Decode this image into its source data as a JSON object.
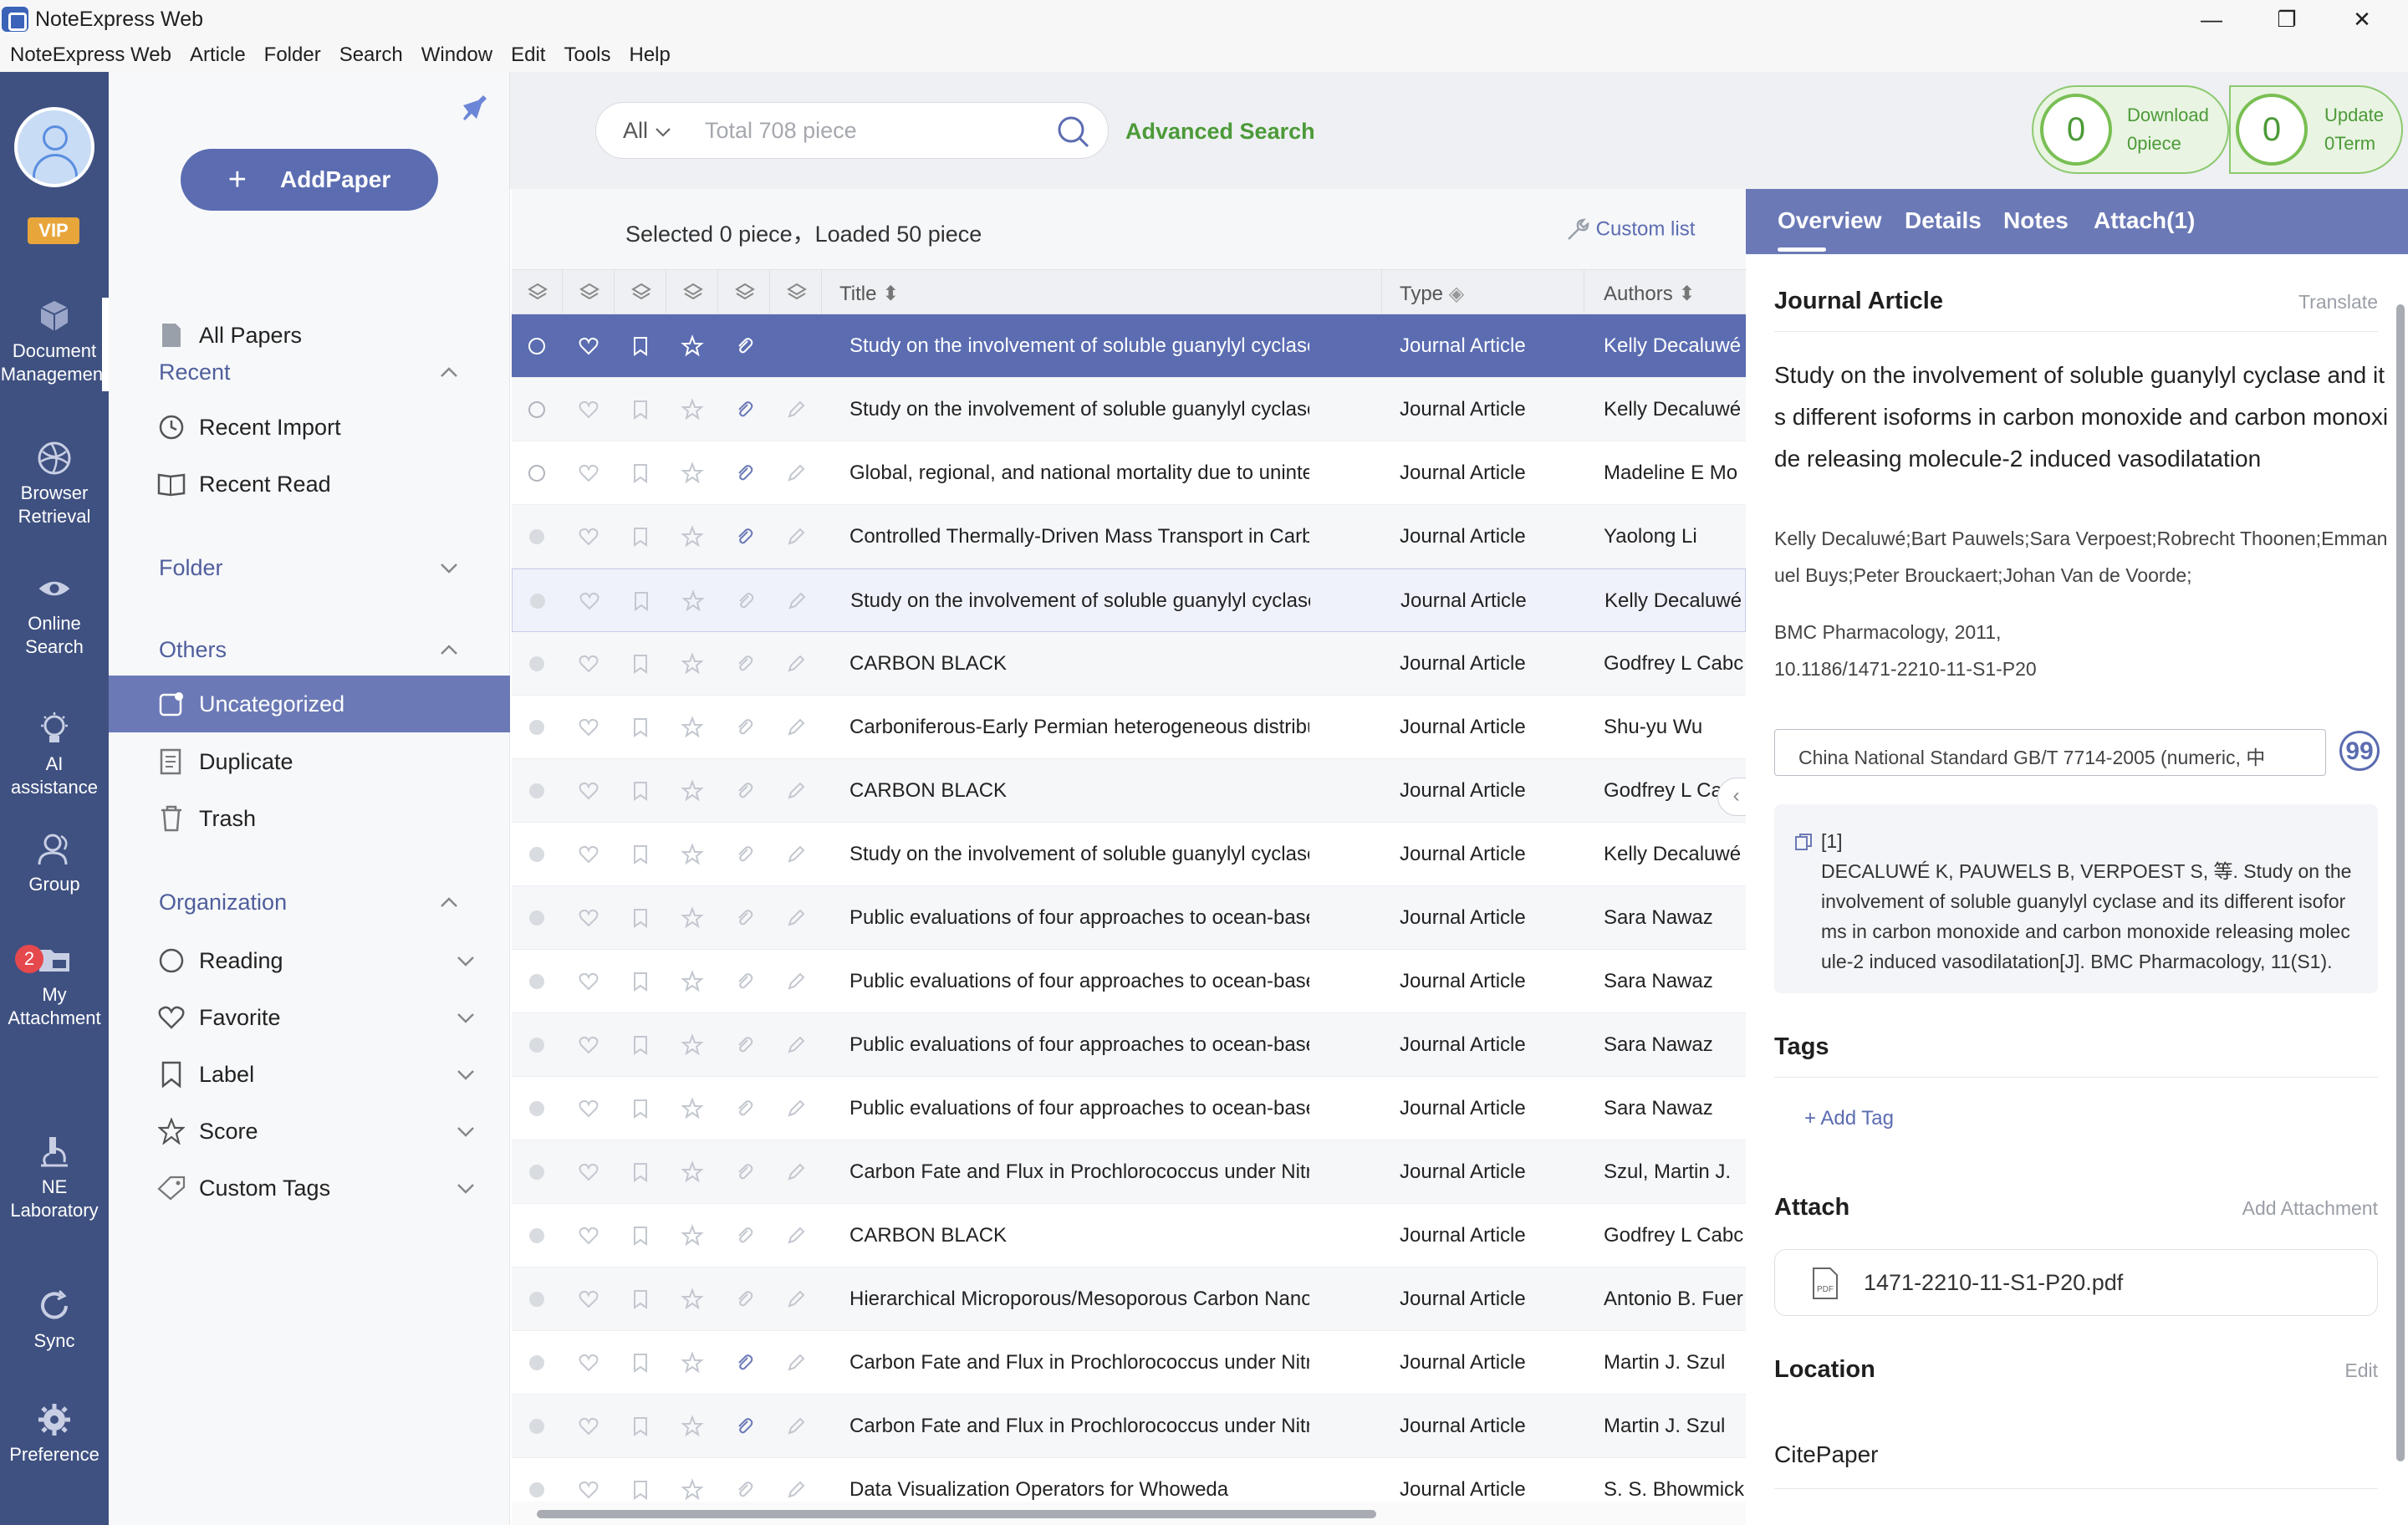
{
  "window": {
    "title": "NoteExpress Web",
    "minimize": "—",
    "maximize": "❐",
    "close": "✕"
  },
  "menu": [
    "NoteExpress Web",
    "Article",
    "Folder",
    "Search",
    "Window",
    "Edit",
    "Tools",
    "Help"
  ],
  "rail": {
    "vip": "VIP",
    "items": [
      {
        "label": "Document Management",
        "icon": "box-icon"
      },
      {
        "label": "Browser Retrieval",
        "icon": "globe-icon"
      },
      {
        "label": "Online Search",
        "icon": "eye-icon"
      },
      {
        "label": "AI assistance",
        "icon": "bulb-icon"
      },
      {
        "label": "Group",
        "icon": "users-icon"
      },
      {
        "label": "My Attachment",
        "icon": "folder-icon"
      },
      {
        "label": "NE Laboratory",
        "icon": "microscope-icon"
      },
      {
        "label": "Sync",
        "icon": "sync-icon"
      },
      {
        "label": "Preference",
        "icon": "gear-icon"
      }
    ],
    "attachment_badge": "2"
  },
  "sidebar": {
    "add_paper": "AddPaper",
    "all_papers": "All Papers",
    "recent": {
      "label": "Recent",
      "items": [
        "Recent Import",
        "Recent Read"
      ]
    },
    "folder": "Folder",
    "others": {
      "label": "Others",
      "items": [
        "Uncategorized",
        "Duplicate",
        "Trash"
      ]
    },
    "organization": {
      "label": "Organization",
      "items": [
        "Reading",
        "Favorite",
        "Label",
        "Score",
        "Custom Tags"
      ]
    }
  },
  "search": {
    "scope": "All",
    "placeholder": "Total 708 piece",
    "advanced": "Advanced Search",
    "download": {
      "count": "0",
      "label": "Download",
      "sub": "0piece"
    },
    "update": {
      "count": "0",
      "label": "Update",
      "sub": "0Term"
    }
  },
  "list": {
    "status": "Selected 0 piece，Loaded 50 piece",
    "custom_list": "Custom list",
    "columns": {
      "title": "Title",
      "type": "Type",
      "authors": "Authors"
    },
    "rows": [
      {
        "title": "Study on the involvement of soluble guanylyl cyclase and its",
        "type": "Journal Article",
        "authors": "Kelly Decaluwé",
        "attach": true
      },
      {
        "title": "Study on the involvement of soluble guanylyl cyclase and its",
        "type": "Journal Article",
        "authors": "Kelly Decaluwé",
        "attach": true
      },
      {
        "title": "Global, regional, and national mortality due to unintentional",
        "type": "Journal Article",
        "authors": "Madeline E Mo",
        "attach": true
      },
      {
        "title": "Controlled Thermally-Driven Mass Transport in Carbon Nano",
        "type": "Journal Article",
        "authors": "Yaolong Li",
        "attach": true
      },
      {
        "title": "Study on the involvement of soluble guanylyl cyclase and its",
        "type": "Journal Article",
        "authors": "Kelly Decaluwé",
        "attach": false
      },
      {
        "title": "CARBON BLACK",
        "type": "Journal Article",
        "authors": "Godfrey L Cabc",
        "attach": false
      },
      {
        "title": "Carboniferous-Early Permian heterogeneous distribution of p",
        "type": "Journal Article",
        "authors": "Shu-yu Wu",
        "attach": false
      },
      {
        "title": "CARBON BLACK",
        "type": "Journal Article",
        "authors": "Godfrey L Ca",
        "attach": false
      },
      {
        "title": "Study on the involvement of soluble guanylyl cyclase and its",
        "type": "Journal Article",
        "authors": "Kelly Decaluwé",
        "attach": false
      },
      {
        "title": "Public evaluations of four approaches to ocean-based carbo",
        "type": "Journal Article",
        "authors": "Sara Nawaz",
        "attach": false
      },
      {
        "title": "Public evaluations of four approaches to ocean-based carbo",
        "type": "Journal Article",
        "authors": "Sara Nawaz",
        "attach": false
      },
      {
        "title": "Public evaluations of four approaches to ocean-based carbo",
        "type": "Journal Article",
        "authors": "Sara Nawaz",
        "attach": false
      },
      {
        "title": "Public evaluations of four approaches to ocean-based carbo",
        "type": "Journal Article",
        "authors": "Sara Nawaz",
        "attach": false
      },
      {
        "title": "Carbon Fate and Flux in Prochlorococcus under Nitrogen Lim",
        "type": "Journal Article",
        "authors": "Szul, Martin J.",
        "attach": false
      },
      {
        "title": "CARBON BLACK",
        "type": "Journal Article",
        "authors": "Godfrey L Cabc",
        "attach": false
      },
      {
        "title": "Hierarchical Microporous/Mesoporous Carbon Nanosheets f",
        "type": "Journal Article",
        "authors": "Antonio B. Fuer",
        "attach": false
      },
      {
        "title": "Carbon Fate and Flux in Prochlorococcus under Nitrogen Lim",
        "type": "Journal Article",
        "authors": "Martin J. Szul",
        "attach": true
      },
      {
        "title": "Carbon Fate and Flux in Prochlorococcus under Nitrogen Lim",
        "type": "Journal Article",
        "authors": "Martin J. Szul",
        "attach": true
      },
      {
        "title": "Data Visualization Operators for Whoweda",
        "type": "Journal Article",
        "authors": "S. S. Bhowmick",
        "attach": false
      }
    ]
  },
  "detail": {
    "tabs": [
      "Overview",
      "Details",
      "Notes",
      "Attach(1)"
    ],
    "type": "Journal Article",
    "translate": "Translate",
    "title": "Study on the involvement of soluble guanylyl cyclase and its different isoforms in carbon monoxide and carbon monoxide releasing molecule-2 induced vasodilatation",
    "authors": "Kelly Decaluwé;Bart Pauwels;Sara Verpoest;Robrecht Thoonen;Emmanuel Buys;Peter Brouckaert;Johan Van de Voorde;",
    "journal": "BMC Pharmacology, 2011,",
    "doi": "10.1186/1471-2210-11-S1-P20",
    "style": "China National Standard GB/T 7714-2005 (numeric, 中",
    "quote_icon": "99",
    "citation": "[1]\nDECALUWÉ K, PAUWELS B, VERPOEST S, 等. Study on the involvement of soluble guanylyl cyclase and its different isoforms in carbon monoxide and carbon monoxide releasing molecule-2 induced vasodilatation[J]. BMC Pharmacology, 11(S1).",
    "tags_heading": "Tags",
    "add_tag": "+ Add Tag",
    "attach_heading": "Attach",
    "add_attachment": "Add Attachment",
    "attachment_file": "1471-2210-11-S1-P20.pdf",
    "location_heading": "Location",
    "edit": "Edit",
    "location": "CitePaper"
  }
}
